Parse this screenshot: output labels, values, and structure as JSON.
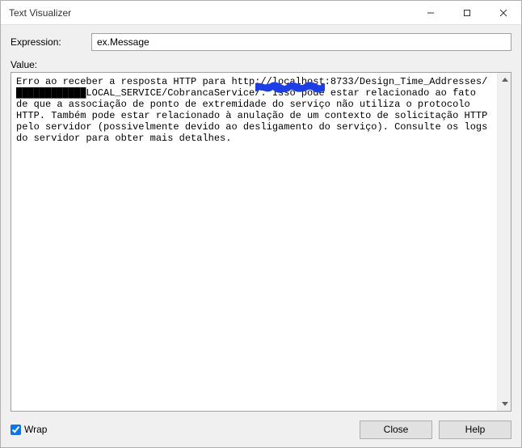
{
  "window": {
    "title": "Text Visualizer"
  },
  "expression": {
    "label": "Expression:",
    "value": "ex.Message"
  },
  "value": {
    "label": "Value:",
    "text": "Erro ao receber a resposta HTTP para http://localhost:8733/Design_Time_Addresses/████████████LOCAL_SERVICE/CobrancaService/. Isso pode estar relacionado ao fato de que a associação de ponto de extremidade do serviço não utiliza o protocolo HTTP. Também pode estar relacionado à anulação de um contexto de solicitação HTTP pelo servidor (possivelmente devido ao desligamento do serviço). Consulte os logs do servidor para obter mais detalhes."
  },
  "footer": {
    "wrap_label": "Wrap",
    "wrap_checked": true,
    "close_label": "Close",
    "help_label": "Help"
  }
}
